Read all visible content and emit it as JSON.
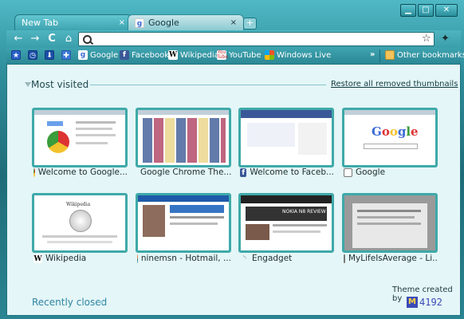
{
  "window": {
    "controls": {
      "minimize": "▁",
      "maximize": "□",
      "close": "✕"
    }
  },
  "tabs": [
    {
      "label": "New Tab",
      "close": "×",
      "active": true
    },
    {
      "label": "Google",
      "close": "×",
      "active": false
    }
  ],
  "toolbar": {
    "back": "←",
    "forward": "→",
    "reload": "C",
    "home": "⌂",
    "omnibox_value": "",
    "star": "☆",
    "wrench": "🔧"
  },
  "bookmarks": {
    "icons": [
      "star-app",
      "clock-app",
      "download-app",
      "puzzle-app"
    ],
    "items": [
      {
        "label": "Google",
        "icon": "google-icon"
      },
      {
        "label": "Facebook",
        "icon": "facebook-icon"
      },
      {
        "label": "Wikipedia",
        "icon": "wikipedia-icon"
      },
      {
        "label": "YouTube",
        "icon": "youtube-icon"
      },
      {
        "label": "Windows Live",
        "icon": "windows-live-icon"
      }
    ],
    "overflow": "»",
    "other": "Other bookmarks"
  },
  "most_visited": {
    "title": "Most visited",
    "restore": "Restore all removed thumbnails",
    "tiles": [
      {
        "caption": "Welcome to Google...",
        "icon": "chrome-icon"
      },
      {
        "caption": "Google Chrome The...",
        "icon": "chrome-icon"
      },
      {
        "caption": "Welcome to Faceb...",
        "icon": "facebook-icon"
      },
      {
        "caption": "Google",
        "icon": "page-icon"
      },
      {
        "caption": "Wikipedia",
        "icon": "wikipedia-icon"
      },
      {
        "caption": "ninemsn - Hotmail, ...",
        "icon": "ninemsn-icon"
      },
      {
        "caption": "Engadget",
        "icon": "rss-icon"
      },
      {
        "caption": "MyLifeIsAverage - Li...",
        "icon": "page-icon"
      }
    ]
  },
  "recently_closed": "Recently closed",
  "theme": {
    "credit": "Theme created by",
    "logo_letter": "M",
    "logo_number": "4192"
  },
  "colors": {
    "frame": "#2f8f9c",
    "content_bg": "#e4f6f7",
    "thumb_border": "#3fa9a9",
    "link": "#2e85a2"
  }
}
